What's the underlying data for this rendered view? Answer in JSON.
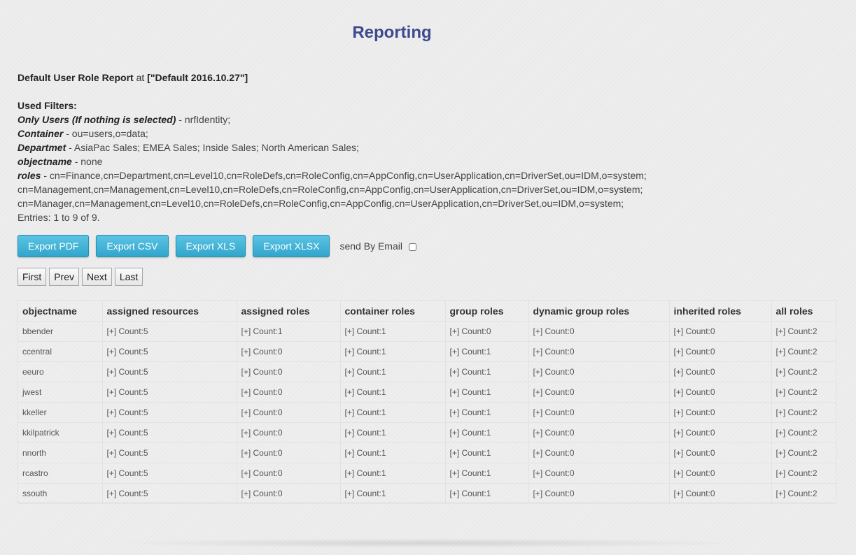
{
  "page": {
    "title": "Reporting"
  },
  "report": {
    "name": "Default User Role Report",
    "at_word": "at",
    "snapshot": "[\"Default 2016.10.27\"]"
  },
  "filters": {
    "header": "Used Filters:",
    "items": [
      {
        "label": "Only Users (If nothing is selected)",
        "value": " - nrfIdentity;"
      },
      {
        "label": "Container",
        "value": " - ou=users,o=data;"
      },
      {
        "label": "Departmet",
        "value": " - AsiaPac Sales; EMEA Sales; Inside Sales; North American Sales;"
      },
      {
        "label": "objectname",
        "value": " - none"
      },
      {
        "label": "roles",
        "value": " - cn=Finance,cn=Department,cn=Level10,cn=RoleDefs,cn=RoleConfig,cn=AppConfig,cn=UserApplication,cn=DriverSet,ou=IDM,o=system;"
      }
    ],
    "roles_continued": [
      "cn=Management,cn=Management,cn=Level10,cn=RoleDefs,cn=RoleConfig,cn=AppConfig,cn=UserApplication,cn=DriverSet,ou=IDM,o=system;",
      "cn=Manager,cn=Management,cn=Level10,cn=RoleDefs,cn=RoleConfig,cn=AppConfig,cn=UserApplication,cn=DriverSet,ou=IDM,o=system;"
    ],
    "entries": "Entries: 1 to 9 of 9."
  },
  "export": {
    "pdf": "Export PDF",
    "csv": "Export CSV",
    "xls": "Export XLS",
    "xlsx": "Export XLSX",
    "email_label": "send By Email",
    "email_checked": false
  },
  "pager": {
    "first": "First",
    "prev": "Prev",
    "next": "Next",
    "last": "Last"
  },
  "table": {
    "headers": [
      "objectname",
      "assigned resources",
      "assigned roles",
      "container roles",
      "group roles",
      "dynamic group roles",
      "inherited roles",
      "all roles"
    ],
    "rows": [
      [
        "bbender",
        "[+] Count:5",
        "[+] Count:1",
        "[+] Count:1",
        "[+] Count:0",
        "[+] Count:0",
        "[+] Count:0",
        "[+] Count:2"
      ],
      [
        "ccentral",
        "[+] Count:5",
        "[+] Count:0",
        "[+] Count:1",
        "[+] Count:1",
        "[+] Count:0",
        "[+] Count:0",
        "[+] Count:2"
      ],
      [
        "eeuro",
        "[+] Count:5",
        "[+] Count:0",
        "[+] Count:1",
        "[+] Count:1",
        "[+] Count:0",
        "[+] Count:0",
        "[+] Count:2"
      ],
      [
        "jwest",
        "[+] Count:5",
        "[+] Count:0",
        "[+] Count:1",
        "[+] Count:1",
        "[+] Count:0",
        "[+] Count:0",
        "[+] Count:2"
      ],
      [
        "kkeller",
        "[+] Count:5",
        "[+] Count:0",
        "[+] Count:1",
        "[+] Count:1",
        "[+] Count:0",
        "[+] Count:0",
        "[+] Count:2"
      ],
      [
        "kkilpatrick",
        "[+] Count:5",
        "[+] Count:0",
        "[+] Count:1",
        "[+] Count:1",
        "[+] Count:0",
        "[+] Count:0",
        "[+] Count:2"
      ],
      [
        "nnorth",
        "[+] Count:5",
        "[+] Count:0",
        "[+] Count:1",
        "[+] Count:1",
        "[+] Count:0",
        "[+] Count:0",
        "[+] Count:2"
      ],
      [
        "rcastro",
        "[+] Count:5",
        "[+] Count:0",
        "[+] Count:1",
        "[+] Count:1",
        "[+] Count:0",
        "[+] Count:0",
        "[+] Count:2"
      ],
      [
        "ssouth",
        "[+] Count:5",
        "[+] Count:0",
        "[+] Count:1",
        "[+] Count:1",
        "[+] Count:0",
        "[+] Count:0",
        "[+] Count:2"
      ]
    ]
  },
  "colors": {
    "title": "#3d4a8f",
    "export_button": "#31a5cc",
    "background": "#ececec"
  }
}
